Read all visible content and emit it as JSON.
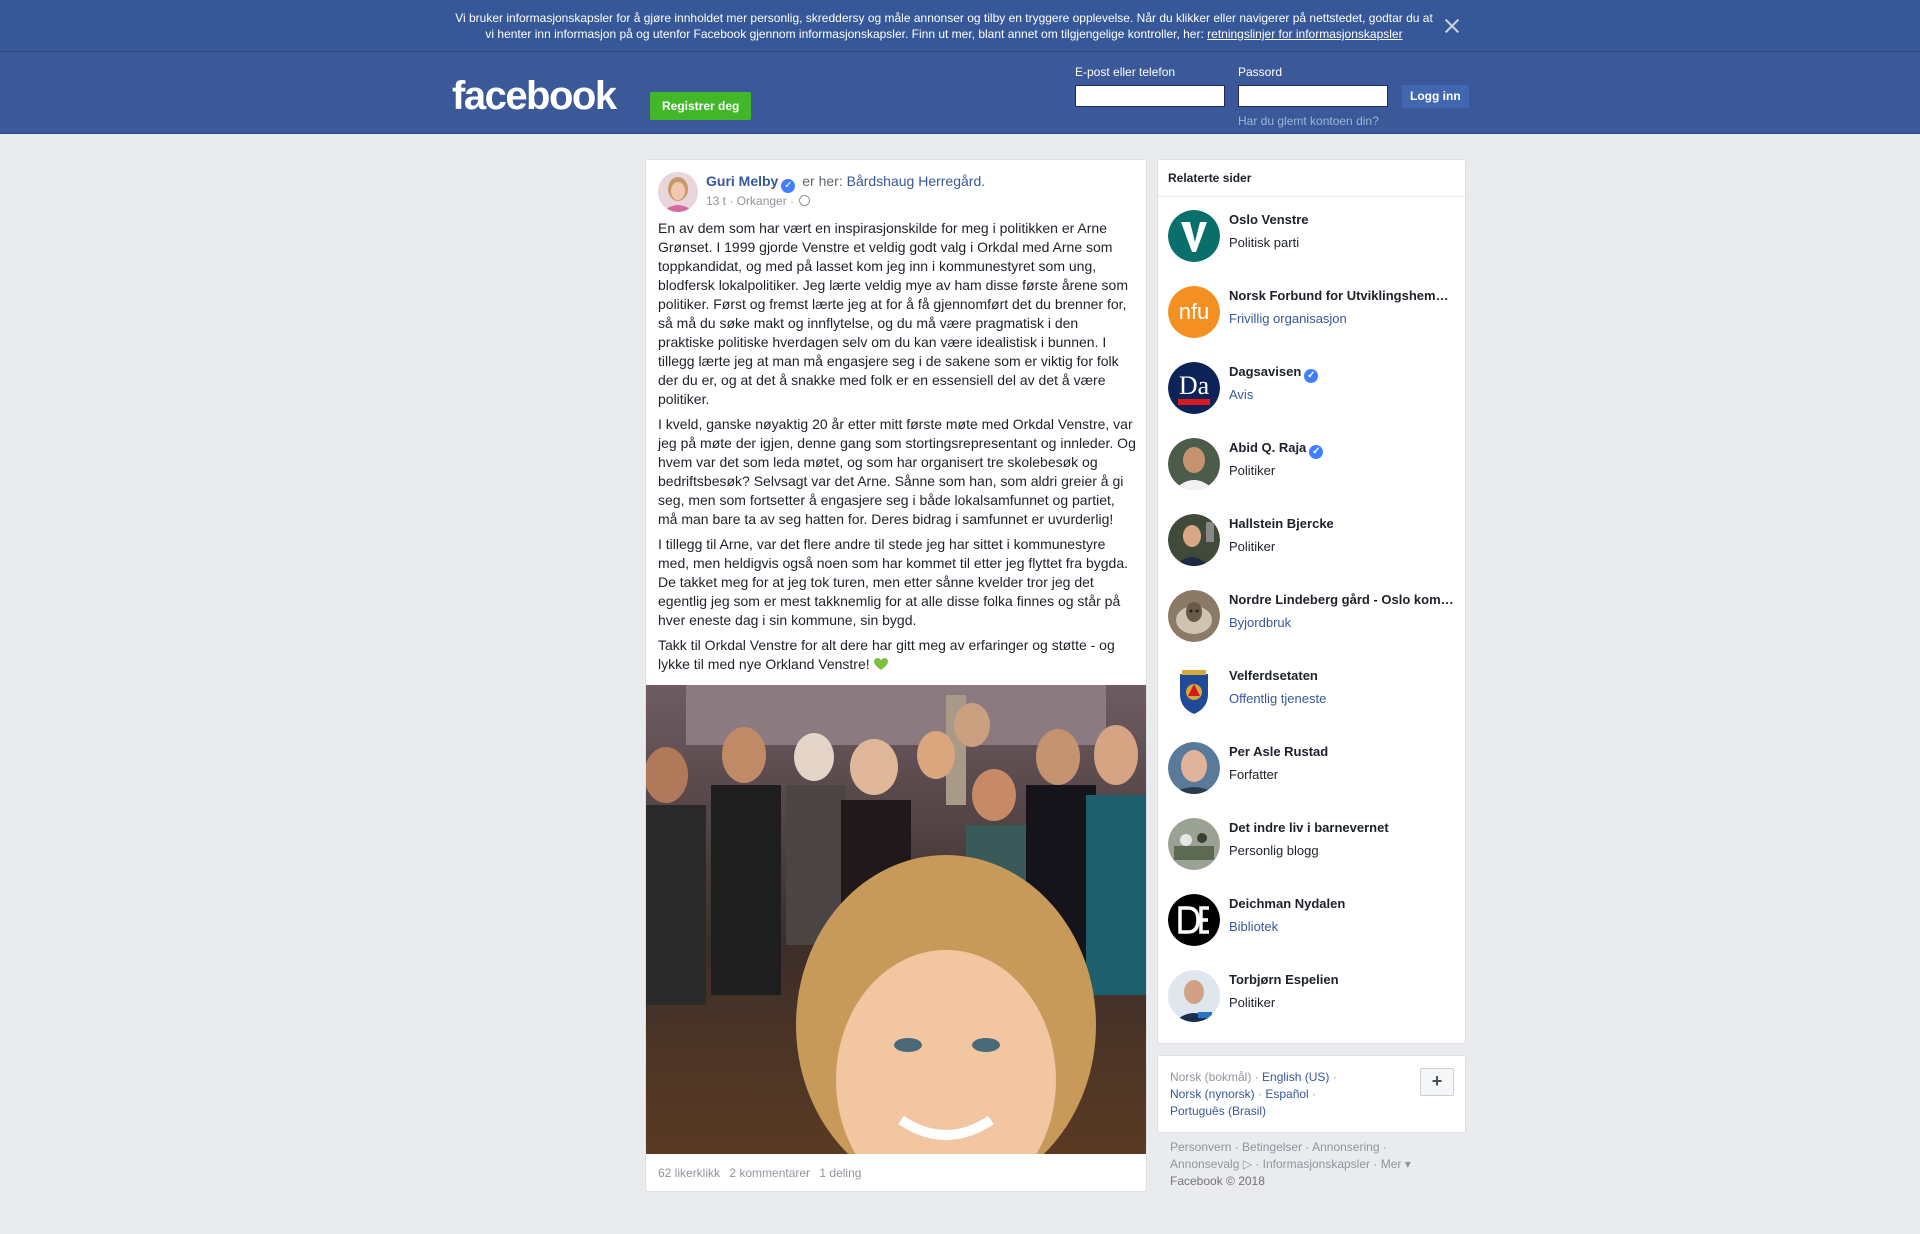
{
  "cookie_banner": {
    "text": "Vi bruker informasjonskapsler for å gjøre innholdet mer personlig, skreddersy og måle annonser og tilby en tryggere opplevelse. Når du klikker eller navigerer på nettstedet, godtar du at vi henter inn informasjon på og utenfor Facebook gjennom informasjonskapsler. Finn ut mer, blant annet om tilgjengelige kontroller, her: ",
    "link_text": "retningslinjer for informasjonskapsler",
    "close_icon": "close-icon"
  },
  "header": {
    "logo": "facebook",
    "register_label": "Registrer deg",
    "email_label": "E-post eller telefon",
    "password_label": "Passord",
    "login_label": "Logg inn",
    "forgot_label": "Har du glemt kontoen din?"
  },
  "post": {
    "author": "Guri Melby",
    "is_at": "er her:",
    "place": "Bårdshaug Herregård.",
    "time": "13 t",
    "location": "Orkanger",
    "paragraphs": [
      "En av dem som har vært en inspirasjonskilde for meg i politikken er Arne Grønset. I 1999 gjorde Venstre et veldig godt valg i Orkdal med Arne som toppkandidat, og med på lasset kom jeg inn i kommunestyret som ung, blodfersk lokalpolitiker. Jeg lærte veldig mye av ham disse første årene som politiker. Først og fremst lærte jeg at for å få gjennomført det du brenner for, så må du søke makt og innflytelse, og du må være pragmatisk i den praktiske politiske hverdagen selv om du kan være idealistisk i bunnen. I tillegg lærte jeg at man må engasjere seg i de sakene som er viktig for folk der du er, og at det å snakke med folk er en essensiell del av det å være politiker.",
      "I kveld, ganske nøyaktig 20 år etter mitt første møte med Orkdal Venstre, var jeg på møte der igjen, denne gang som stortingsrepresentant og innleder. Og hvem var det som leda møtet, og som har organisert tre skolebesøk og bedriftsbesøk? Selvsagt var det Arne. Sånne som han, som aldri greier å gi seg, men som fortsetter å engasjere seg i både lokalsamfunnet og partiet, må man bare ta av seg hatten for. Deres bidrag i samfunnet er uvurderlig!",
      "I tillegg til Arne, var det flere andre til stede jeg har sittet i kommunestyre med, men heldigvis også noen som har kommet til etter jeg flyttet fra bygda. De takket meg for at jeg tok turen, men etter sånne kvelder tror jeg det egentlig jeg som er mest takknemlig for at alle disse folka finnes og står på hver eneste dag i sin kommune, sin bygd.",
      "Takk til Orkdal Venstre for alt dere har gitt meg av erfaringer og støtte - og lykke til med nye Orkland Venstre!"
    ],
    "likes": "62 likerklikk",
    "comments": "2 kommentarer",
    "shares": "1 deling"
  },
  "related": {
    "title": "Relaterte sider",
    "items": [
      {
        "name": "Oslo Venstre",
        "category": "Politisk parti",
        "verified": false,
        "link": false,
        "icon": "oslo-venstre-logo-icon"
      },
      {
        "name": "Norsk Forbund for Utviklingshemmede",
        "category": "Frivillig organisasjon",
        "verified": false,
        "link": true,
        "icon": "nfu-logo-icon"
      },
      {
        "name": "Dagsavisen",
        "category": "Avis",
        "verified": true,
        "link": true,
        "icon": "dagsavisen-logo-icon"
      },
      {
        "name": "Abid Q. Raja",
        "category": "Politiker",
        "verified": true,
        "link": false,
        "icon": "person-photo-icon"
      },
      {
        "name": "Hallstein Bjercke",
        "category": "Politiker",
        "verified": false,
        "link": false,
        "icon": "person-photo-icon"
      },
      {
        "name": "Nordre Lindeberg gård - Oslo kommune",
        "category": "Byjordbruk",
        "verified": false,
        "link": true,
        "icon": "sheep-photo-icon"
      },
      {
        "name": "Velferdsetaten",
        "category": "Offentlig tjeneste",
        "verified": false,
        "link": true,
        "icon": "oslo-coat-of-arms-icon"
      },
      {
        "name": "Per Asle Rustad",
        "category": "Forfatter",
        "verified": false,
        "link": false,
        "icon": "person-photo-icon"
      },
      {
        "name": "Det indre liv i barnevernet",
        "category": "Personlig blogg",
        "verified": false,
        "link": false,
        "icon": "blog-photo-icon"
      },
      {
        "name": "Deichman Nydalen",
        "category": "Bibliotek",
        "verified": false,
        "link": true,
        "icon": "deichman-logo-icon"
      },
      {
        "name": "Torbjørn Espelien",
        "category": "Politiker",
        "verified": false,
        "link": false,
        "icon": "person-photo-icon"
      }
    ]
  },
  "languages": {
    "current": "Norsk (bokmål)",
    "options": [
      "English (US)",
      "Norsk (nynorsk)",
      "Español",
      "Português (Brasil)"
    ],
    "plus": "+"
  },
  "footer": {
    "links": [
      "Personvern",
      "Betingelser",
      "Annonsering",
      "Annonsevalg",
      "Informasjonskapsler",
      "Mer"
    ],
    "copyright": "Facebook © 2018"
  },
  "colors": {
    "brand_blue": "#3b5998",
    "cookie_blue": "#365899",
    "register_green": "#42b72a",
    "link_blue": "#365899",
    "page_bg": "#e9ebee"
  }
}
